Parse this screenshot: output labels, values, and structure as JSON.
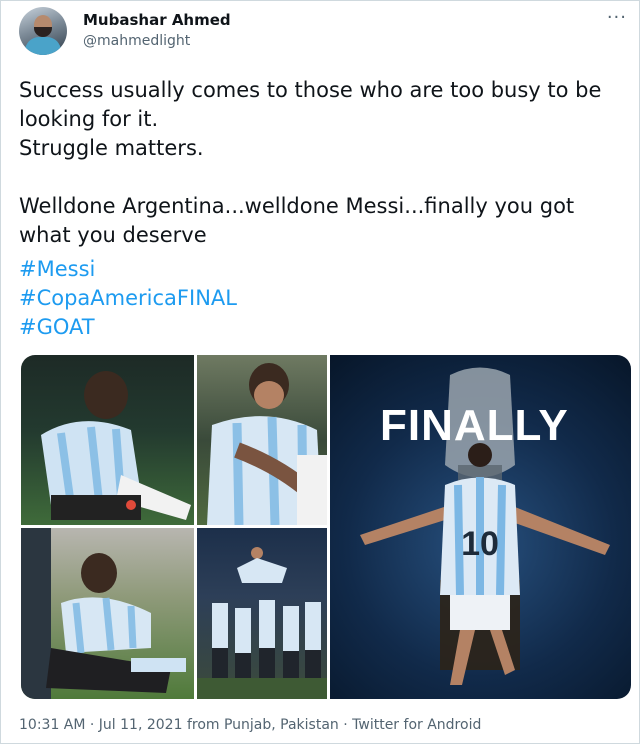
{
  "author": {
    "name": "Mubashar Ahmed",
    "handle": "@mahmedlight"
  },
  "more_icon": "more-horizontal-icon",
  "tweet": {
    "text": "Success usually comes to those who are too busy to be\nlooking for it.\nStruggle matters.\n\nWelldone Argentina...welldone Messi...finally you got\nwhat you deserve",
    "hashtags": [
      "#Messi",
      "#CopaAmericaFINAL",
      "#GOAT"
    ]
  },
  "media": {
    "overlay_text": "FINALLY"
  },
  "footer": "10:31 AM · Jul 11, 2021 from Punjab, Pakistan · Twitter for Android",
  "colors": {
    "link": "#1d9bf0",
    "text": "#0f1419",
    "muted": "#536471",
    "border": "#cfd9de"
  }
}
